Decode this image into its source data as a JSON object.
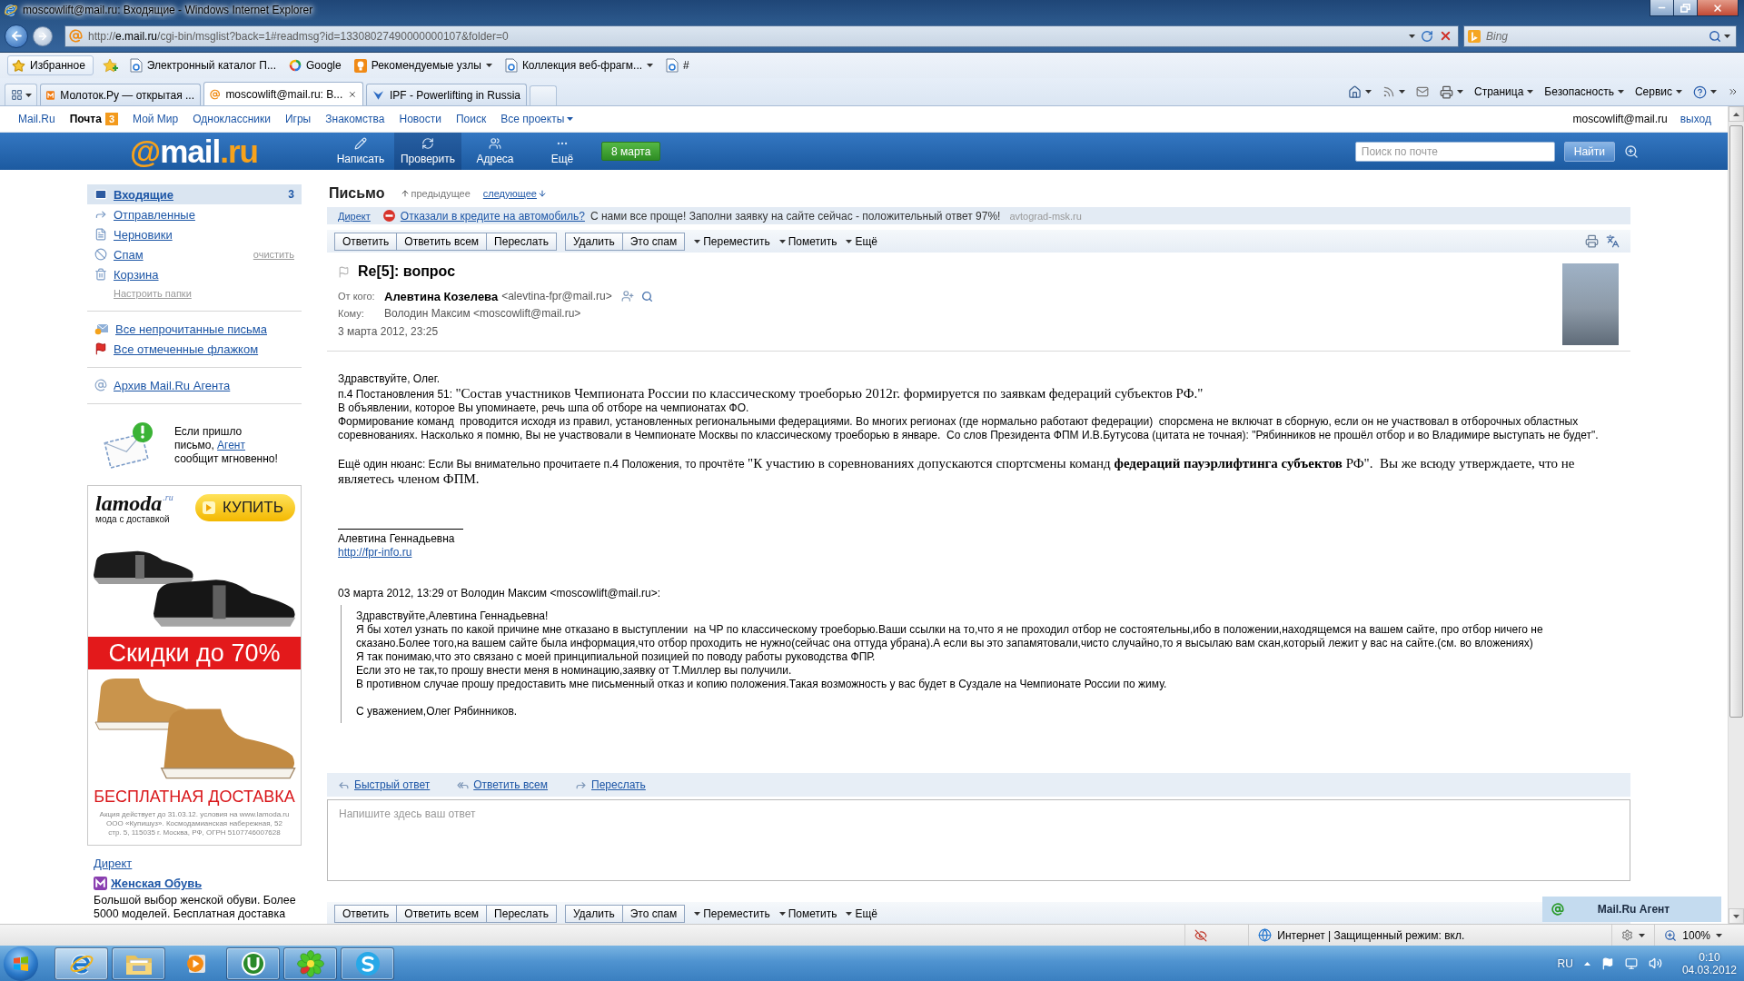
{
  "window": {
    "title": "moscowlift@mail.ru: Входящие - Windows Internet Explorer"
  },
  "address_bar": {
    "scheme": "http://",
    "domain": "e.mail.ru",
    "path": "/cgi-bin/msglist?back=1#readmsg?id=13308027490000000107&folder=0",
    "search_placeholder": "Bing"
  },
  "favorites_bar": [
    {
      "label": "Избранное",
      "kind": "favorites",
      "dropdown": false
    },
    {
      "label": "Электронный каталог П...",
      "kind": "page",
      "dropdown": false
    },
    {
      "label": "Google",
      "kind": "google",
      "dropdown": false
    },
    {
      "label": "Рекомендуемые узлы",
      "kind": "suggested",
      "dropdown": true
    },
    {
      "label": "Коллекция веб-фрагм...",
      "kind": "page",
      "dropdown": true
    },
    {
      "label": "#",
      "kind": "page",
      "dropdown": false
    }
  ],
  "tabs": [
    {
      "label": "Молоток.Ру — открытая ...",
      "kind": "tile",
      "selected": false
    },
    {
      "label": "moscowlift@mail.ru: В...",
      "kind": "mail",
      "selected": true
    },
    {
      "label": "IPF - Powerlifting in Russia",
      "kind": "chevron",
      "selected": false
    }
  ],
  "command_bar": [
    "Страница",
    "Безопасность",
    "Сервис"
  ],
  "portal_nav": {
    "items": [
      {
        "label": "Mail.Ru",
        "selected": false
      },
      {
        "label": "Почта",
        "selected": true,
        "badge": "3"
      },
      {
        "label": "Мой Мир",
        "selected": false
      },
      {
        "label": "Одноклассники",
        "selected": false
      },
      {
        "label": "Игры",
        "selected": false
      },
      {
        "label": "Знакомства",
        "selected": false
      },
      {
        "label": "Новости",
        "selected": false
      },
      {
        "label": "Поиск",
        "selected": false
      }
    ],
    "projects_menu": "Все проекты",
    "user": "moscowlift@mail.ru",
    "logout": "выход"
  },
  "mail_header": {
    "logo": [
      "@",
      "mail",
      ".ru"
    ],
    "actions": [
      {
        "label": "Написать",
        "kind": "compose",
        "selected": false
      },
      {
        "label": "Проверить",
        "kind": "check",
        "selected": true
      },
      {
        "label": "Адреса",
        "kind": "contacts",
        "selected": false
      },
      {
        "label": "Ещё",
        "kind": "more",
        "selected": false
      }
    ],
    "holiday_button": "8 марта",
    "search_placeholder": "Поиск по почте",
    "search_button": "Найти"
  },
  "sidebar": {
    "folders": [
      {
        "label": "Входящие",
        "kind": "inbox",
        "selected": true,
        "count": "3"
      },
      {
        "label": "Отправленные",
        "kind": "sent",
        "selected": false
      },
      {
        "label": "Черновики",
        "kind": "drafts",
        "selected": false
      },
      {
        "label": "Спам",
        "kind": "spam",
        "selected": false,
        "action": "очистить"
      },
      {
        "label": "Корзина",
        "kind": "trash",
        "selected": false
      }
    ],
    "settings_link": "Настроить папки",
    "filters": [
      {
        "label": "Все непрочитанные письма",
        "kind": "unread"
      },
      {
        "label": "Все отмеченные флажком",
        "kind": "flagged"
      }
    ],
    "archive": "Архив Mail.Ru Агента",
    "agent_promo": {
      "before": "Если пришло письмо,",
      "link": "Агент",
      "after": "сообщит мгновенно!"
    },
    "banner": {
      "brand": "lamoda",
      "brand_suffix": ".ru",
      "tagline": "мода с доставкой",
      "button": "КУПИТЬ",
      "sale": "Скидки до 70%",
      "delivery": "БЕСПЛАТНАЯ ДОСТАВКА",
      "fine_print": [
        "Акция действует до 31.03.12. условия на www.lamoda.ru",
        "ООО «Купишуз». Космодамианская  набережная, 52",
        "стр. 5, 115035 г. Москва, РФ, ОГРН 5107746007628"
      ]
    },
    "direct": {
      "label": "Директ",
      "ad_title": "Женская Обувь",
      "ad_text": "Большой выбор женской обуви. Более 5000 моделей. Бесплатная доставка"
    }
  },
  "message": {
    "heading": "Письмо",
    "prev": "предыдущее",
    "next": "следующее",
    "direct": {
      "label": "Директ",
      "link": "Отказали в кредите на автомобиль?",
      "text": "С нами все проще! Заполни заявку на сайте сейчас - положительный ответ 97%!",
      "domain": "avtograd-msk.ru"
    },
    "toolbar": {
      "groups": [
        [
          "Ответить",
          "Ответить всем",
          "Переслать"
        ],
        [
          "Удалить",
          "Это спам"
        ]
      ],
      "menus": [
        "Переместить",
        "Пометить",
        "Ещё"
      ]
    },
    "subject": "Re[5]: вопрос",
    "flagged": false,
    "from": {
      "label": "От кого:",
      "name": "Алевтина Козелева",
      "email": "<alevtina-fpr@mail.ru>"
    },
    "to": {
      "label": "Кому:",
      "value": "Володин Максим <moscowlift@mail.ru>"
    },
    "date": "3 марта 2012, 23:25",
    "body": [
      [
        {
          "text": "Здравствуйте, Олег."
        },
        {
          "text": "п.4 Постановления 51: ",
          "quote": "\"Состав участников Чемпионата России по классическому троеборью 2012г. формируется по заявкам федераций субъектов РФ.\""
        },
        {
          "text": "В объявлении, которое Вы упоминаете, речь шпа об отборе на чемпионатах ФО."
        },
        {
          "text": "Формирование команд  проводится исходя из правил, установленных региональными федерациями. Во многих регионах (где нормально работают федерации)  спорсмена не включат в сборную, если он не участвовал в отборочных областных соревнованиях. Насколько я помню, Вы не участвовали в Чемпионате Москвы по классическому троеборью в январе.  Со слов Президента ФПМ И.В.Бутусова (цитата не точная): \"Рябинников не прошёл отбор и во Владимире выступать не будет\"."
        }
      ],
      [
        {
          "text": "Ещё один нюанс: Если Вы внимательно прочитаете п.4 Положения, то прочтёте ",
          "quote": "\"К участию в соревнованиях допускаются спортсмены команд **федераций пауэрлифтинга субъектов** РФ\".  Вы же всюду утверждаете, что не являетесь членом ФПМ."
        }
      ]
    ],
    "signature": {
      "name": "Алевтина Геннадьевна",
      "link": "http://fpr-info.ru"
    },
    "quote_header": "03 марта 2012, 13:29 от Володин Максим <moscowlift@mail.ru>:",
    "quote": [
      [
        "Здравствуйте,Алевтина Геннадьевна!",
        "Я бы хотел узнать по какой причине мне отказано в выступлении  на ЧР по классическому троеборью.Ваши ссылки на то,что я не проходил отбор не состоятельны,ибо в положении,находящемся на вашем сайте, про отбор ничего не сказано.Более того,на вашем сайте была информация,что отбор проходить не нужно(сейчас она оттуда убрана).А если вы это запамятовали,чисто случайно,то я высылаю вам скан,который лежит у вас на сайте.(см. во вложениях)",
        "Я так понимаю,что это связано с моей принципиальной позицией по поводу работы руководства ФПР.",
        "Если это не так,то прошу внести меня в номинацию,заявку от Т.Миллер вы получили.",
        "В противном случае прошу предоставить мне письменный отказ и копию положения.Такая возможность у вас будет в Суздале на Чемпионате России по жиму."
      ],
      [
        "С уважением,Олег Рябинников."
      ]
    ],
    "reply_bar": [
      {
        "label": "Быстрый ответ",
        "kind": "reply"
      },
      {
        "label": "Ответить всем",
        "kind": "reply-all"
      },
      {
        "label": "Переслать",
        "kind": "forward"
      }
    ],
    "reply_placeholder": "Напишите здесь ваш ответ",
    "bottom_toolbar": {
      "groups": [
        [
          "Ответить",
          "Ответить всем",
          "Переслать"
        ],
        [
          "Удалить",
          "Это спам"
        ]
      ],
      "menus": [
        "Переместить",
        "Пометить",
        "Ещё"
      ]
    }
  },
  "agent_panel": {
    "label": "Mail.Ru Агент"
  },
  "status_bar": {
    "zone": "Интернет | Защищенный режим: вкл.",
    "zoom": "100%"
  },
  "taskbar": {
    "apps": [
      {
        "kind": "browser",
        "running": true,
        "active": true
      },
      {
        "kind": "folder",
        "running": true,
        "active": false
      },
      {
        "kind": "player",
        "running": false,
        "active": false
      },
      {
        "kind": "torrent",
        "running": true,
        "active": false
      },
      {
        "kind": "flower",
        "running": true,
        "active": false
      },
      {
        "kind": "chat",
        "running": true,
        "active": false
      }
    ],
    "language": "RU",
    "time": "0:10",
    "date": "04.03.2012"
  }
}
